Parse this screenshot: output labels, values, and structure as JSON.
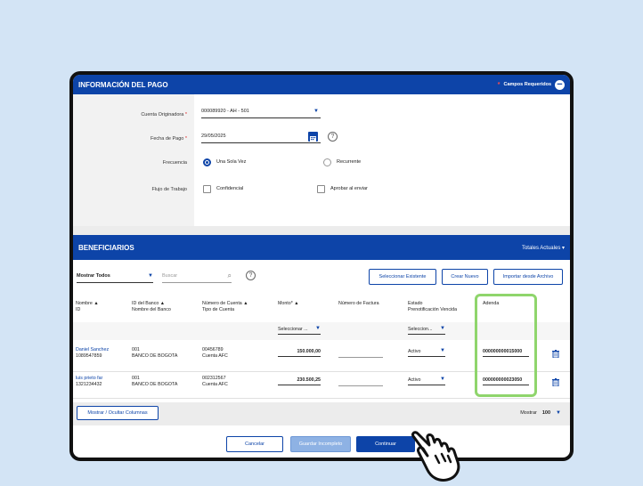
{
  "header": {
    "title": "INFORMACIÓN DEL PAGO",
    "required_label": "Campos Requeridos",
    "required_mark": "*"
  },
  "form": {
    "account_label": "Cuenta Originadora",
    "account_value": "000089920 - AH - 501",
    "date_label": "Fecha de Pago",
    "date_value": "29/05/2025",
    "frequency_label": "Frecuencia",
    "frequency_options": [
      "Una Sola Vez",
      "Recurrente"
    ],
    "workflow_label": "Flujo de Trabajo",
    "workflow_options": [
      "Confidencial",
      "Aprobar al enviar"
    ],
    "required_mark": "*"
  },
  "beneficiaries": {
    "title": "BENEFICIARIOS",
    "totals_label": "Totales Actuales",
    "filter_value": "Mostrar Todos",
    "search_placeholder": "Buscar",
    "buttons": [
      "Seleccionar Existente",
      "Crear Nuevo",
      "Importar desde Archivo"
    ],
    "columns": {
      "name": "Nombre",
      "id": "ID",
      "bank_id": "ID del Banco",
      "bank_name": "Nombre del Banco",
      "account": "Número de Cuenta",
      "account_type": "Tipo de Cuenta",
      "amount": "Monto*",
      "invoice": "Número de Factura",
      "status": "Estado",
      "prenote": "Prenotificación Vencida",
      "addenda": "Adenda"
    },
    "filter_select_amount": "Seleccionar ...",
    "filter_select_status": "Seleccion...",
    "rows": [
      {
        "name": "Daniel Sanchez",
        "id": "1089547859",
        "bank_id": "001",
        "bank_name": "BANCO DE BOGOTA",
        "account": "00456789",
        "account_type": "Cuenta AFC",
        "amount": "150.000,00",
        "status": "Activo",
        "addenda": "000000000015000"
      },
      {
        "name": "luis prieto far",
        "id": "1321234432",
        "bank_id": "001",
        "bank_name": "BANCO DE BOGOTA",
        "account": "002312567",
        "account_type": "Cuenta AFC",
        "amount": "230.500,25",
        "status": "Activo",
        "addenda": "000000000023050"
      }
    ],
    "columns_button": "Mostrar / Ocultar Columnas",
    "show_label": "Mostrar",
    "show_value": "100"
  },
  "actions": {
    "cancel": "Cancelar",
    "save_incomplete": "Guardar Incompleto",
    "continue": "Continuar"
  },
  "colors": {
    "brand": "#0d44a8",
    "highlight": "#8fd56c",
    "background": "#d3e4f5"
  }
}
